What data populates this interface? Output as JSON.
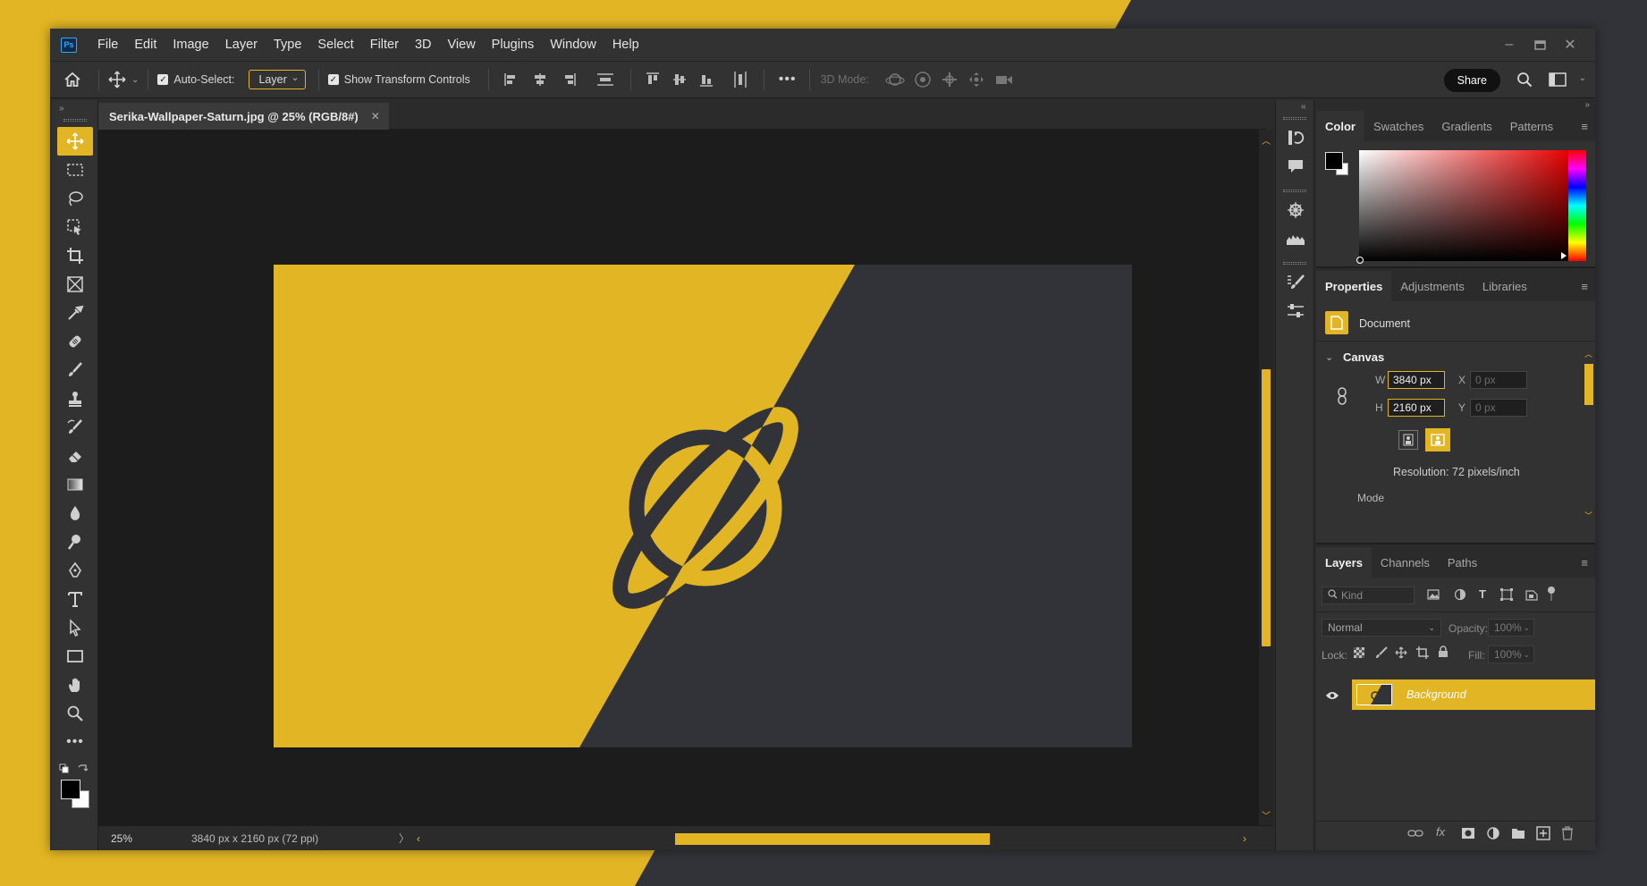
{
  "app": {
    "name": "Photoshop",
    "logo_text": "Ps"
  },
  "colors": {
    "accent": "#e2b524",
    "artboard_dark": "#323338",
    "panel_bg": "#323232",
    "canvas_bg": "#1c1c1c"
  },
  "menu": [
    "File",
    "Edit",
    "Image",
    "Layer",
    "Type",
    "Select",
    "Filter",
    "3D",
    "View",
    "Plugins",
    "Window",
    "Help"
  ],
  "options": {
    "auto_select_label": "Auto-Select:",
    "auto_select_value": "Layer",
    "transform_label": "Show Transform Controls",
    "mode3d_label": "3D Mode:",
    "share_label": "Share"
  },
  "document": {
    "tab_title": "Serika-Wallpaper-Saturn.jpg @ 25% (RGB/8#)",
    "zoom": "25%",
    "info": "3840 px x 2160 px (72 ppi)"
  },
  "color_panel": {
    "tabs": [
      "Color",
      "Swatches",
      "Gradients",
      "Patterns"
    ]
  },
  "properties_panel": {
    "tabs": [
      "Properties",
      "Adjustments",
      "Libraries"
    ],
    "type_label": "Document",
    "section": "Canvas",
    "w_label": "W",
    "w_value": "3840 px",
    "h_label": "H",
    "h_value": "2160 px",
    "x_label": "X",
    "x_value": "0 px",
    "y_label": "Y",
    "y_value": "0 px",
    "resolution": "Resolution: 72 pixels/inch",
    "mode_label": "Mode"
  },
  "layers_panel": {
    "tabs": [
      "Layers",
      "Channels",
      "Paths"
    ],
    "filter_placeholder": "Kind",
    "blend_mode": "Normal",
    "opacity_label": "Opacity:",
    "opacity_value": "100%",
    "lock_label": "Lock:",
    "fill_label": "Fill:",
    "fill_value": "100%",
    "layers": [
      {
        "name": "Background",
        "visible": true,
        "locked": true
      }
    ]
  }
}
